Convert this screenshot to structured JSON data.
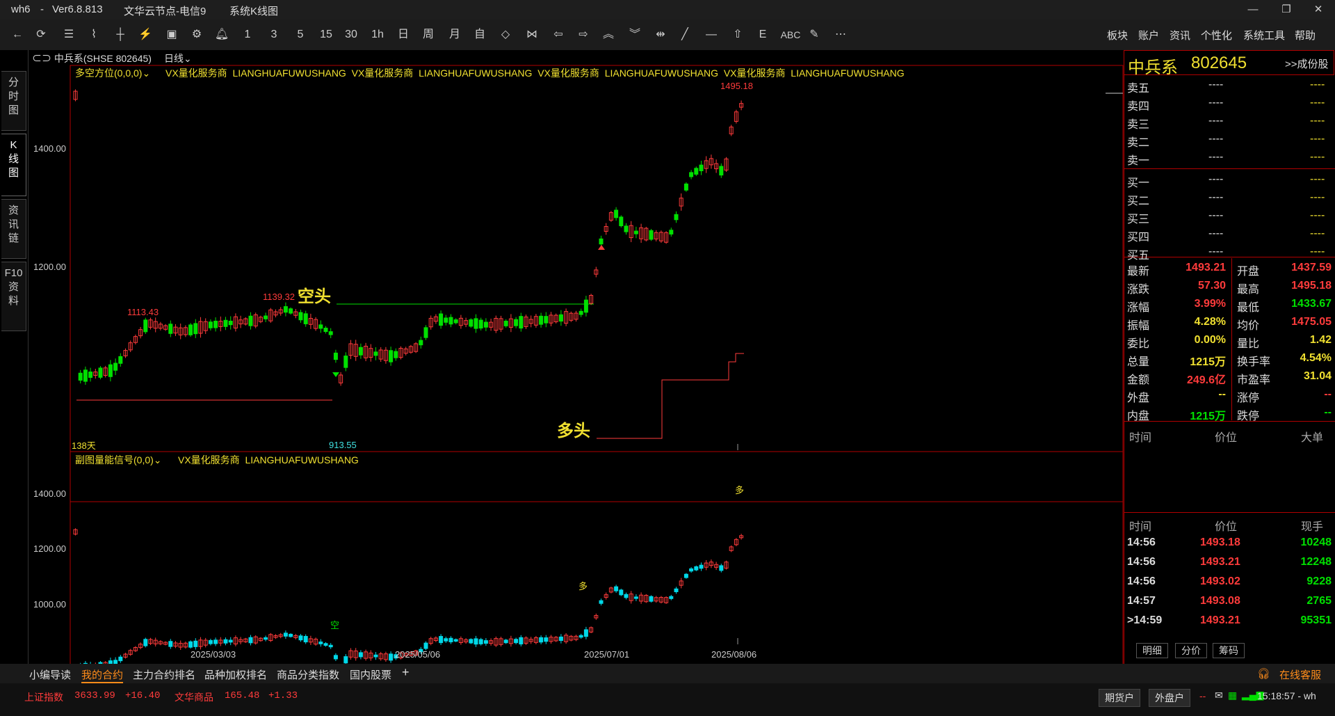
{
  "titlebar": {
    "app": "wh6",
    "sep": "-",
    "version": "Ver6.8.813",
    "node": "文华云节点-电信9",
    "view": "系统K线图"
  },
  "toolbar": {
    "periods": [
      "1",
      "3",
      "5",
      "15",
      "30",
      "1h",
      "日",
      "周",
      "月",
      "自"
    ],
    "text_tools": [
      "ABC"
    ],
    "menus": [
      "板块",
      "账户",
      "资讯",
      "个性化",
      "系统工具",
      "帮助"
    ]
  },
  "left_tabs": [
    {
      "label": "分\n时\n图"
    },
    {
      "label": "K\n线\n图"
    },
    {
      "label": "资\n讯\n链"
    },
    {
      "label": "F10\n资\n料"
    }
  ],
  "chart_header": {
    "symbol": "中兵系(SHSE 802645)",
    "period": "日线",
    "main_indicator": "多空方位(0,0,0)",
    "watermark_cn": "VX量化服务商",
    "watermark_en": "LIANGHUAFUWUSHANG",
    "sub_indicator": "副图量能信号(0,0)"
  },
  "annotations": {
    "high_label": "1495.18",
    "left_high": "1113.43",
    "mid_high": "1139.32",
    "low_label": "913.55",
    "bear_text": "空头",
    "bull_text": "多头",
    "days_label": "138天",
    "sig_duo": "多",
    "sig_kong": "空"
  },
  "chart_data": [
    {
      "type": "candlestick",
      "title": "多空方位(0,0,0)",
      "y_ticks": [
        "1400.00",
        "1200.00"
      ],
      "x_ticks": [
        "2025/03/03",
        "2025/05/06",
        "2025/07/01",
        "2025/08/06"
      ],
      "marked_points": {
        "max": 1495.18,
        "min": 913.55,
        "peak_1": 1113.43,
        "peak_2": 1139.32
      }
    },
    {
      "type": "candlestick",
      "title": "副图量能信号(0,0)",
      "y_ticks": [
        "1400.00",
        "1200.00",
        "1000.00"
      ]
    }
  ],
  "quote": {
    "name": "中兵系",
    "code": "802645",
    "related": ">>成份股",
    "asks": [
      {
        "label": "卖五",
        "price": "----",
        "vol": "----"
      },
      {
        "label": "卖四",
        "price": "----",
        "vol": "----"
      },
      {
        "label": "卖三",
        "price": "----",
        "vol": "----"
      },
      {
        "label": "卖二",
        "price": "----",
        "vol": "----"
      },
      {
        "label": "卖一",
        "price": "----",
        "vol": "----"
      }
    ],
    "bids": [
      {
        "label": "买一",
        "price": "----",
        "vol": "----"
      },
      {
        "label": "买二",
        "price": "----",
        "vol": "----"
      },
      {
        "label": "买三",
        "price": "----",
        "vol": "----"
      },
      {
        "label": "买四",
        "price": "----",
        "vol": "----"
      },
      {
        "label": "买五",
        "price": "----",
        "vol": "----"
      }
    ],
    "stats": [
      {
        "l1": "最新",
        "v1": "1493.21",
        "c1": "red",
        "l2": "开盘",
        "v2": "1437.59",
        "c2": "red"
      },
      {
        "l1": "涨跌",
        "v1": "57.30",
        "c1": "red",
        "l2": "最高",
        "v2": "1495.18",
        "c2": "red"
      },
      {
        "l1": "涨幅",
        "v1": "3.99%",
        "c1": "red",
        "l2": "最低",
        "v2": "1433.67",
        "c2": "green"
      },
      {
        "l1": "振幅",
        "v1": "4.28%",
        "c1": "yellow",
        "l2": "均价",
        "v2": "1475.05",
        "c2": "red"
      },
      {
        "l1": "委比",
        "v1": "0.00%",
        "c1": "yellow",
        "l2": "量比",
        "v2": "1.42",
        "c2": "yellow"
      },
      {
        "l1": "总量",
        "v1": "1215万",
        "c1": "yellow",
        "l2": "换手率",
        "v2": "4.54%",
        "c2": "yellow"
      },
      {
        "l1": "金额",
        "v1": "249.6亿",
        "c1": "red",
        "l2": "市盈率",
        "v2": "31.04",
        "c2": "yellow"
      },
      {
        "l1": "外盘",
        "v1": "--",
        "c1": "yellow",
        "l2": "涨停",
        "v2": "--",
        "c2": "red"
      },
      {
        "l1": "内盘",
        "v1": "1215万",
        "c1": "green",
        "l2": "跌停",
        "v2": "--",
        "c2": "green"
      }
    ],
    "tick_header1": {
      "time": "时间",
      "price": "价位",
      "big": "大单"
    },
    "tick_header2": {
      "time": "时间",
      "price": "价位",
      "hand": "现手"
    },
    "ticks": [
      {
        "time": "14:56",
        "price": "1493.18",
        "hand": "10248"
      },
      {
        "time": "14:56",
        "price": "1493.21",
        "hand": "12248"
      },
      {
        "time": "14:56",
        "price": "1493.02",
        "hand": "9228"
      },
      {
        "time": "14:57",
        "price": "1493.08",
        "hand": "2765"
      },
      {
        "time": ">14:59",
        "price": "1493.21",
        "hand": "95351"
      }
    ],
    "bottom_tabs": [
      "明细",
      "分价",
      "筹码"
    ]
  },
  "bottom_tabs": [
    "小编导读",
    "我的合约",
    "主力合约排名",
    "品种加权排名",
    "商品分类指数",
    "国内股票"
  ],
  "add_tab": "+",
  "service": "在线客服",
  "status": {
    "idx1_name": "上证指数",
    "idx1_val": "3633.99",
    "idx1_chg": "+16.40",
    "idx2_name": "文华商品",
    "idx2_val": "165.48",
    "idx2_chg": "+1.33",
    "btn1": "期货户",
    "btn2": "外盘户",
    "dashes": "--",
    "clock": "15:18:57 - wh"
  },
  "colors": {
    "up": "#ff3b3b",
    "down": "#00e000",
    "accent": "#f0e030",
    "grid": "#b00000"
  }
}
